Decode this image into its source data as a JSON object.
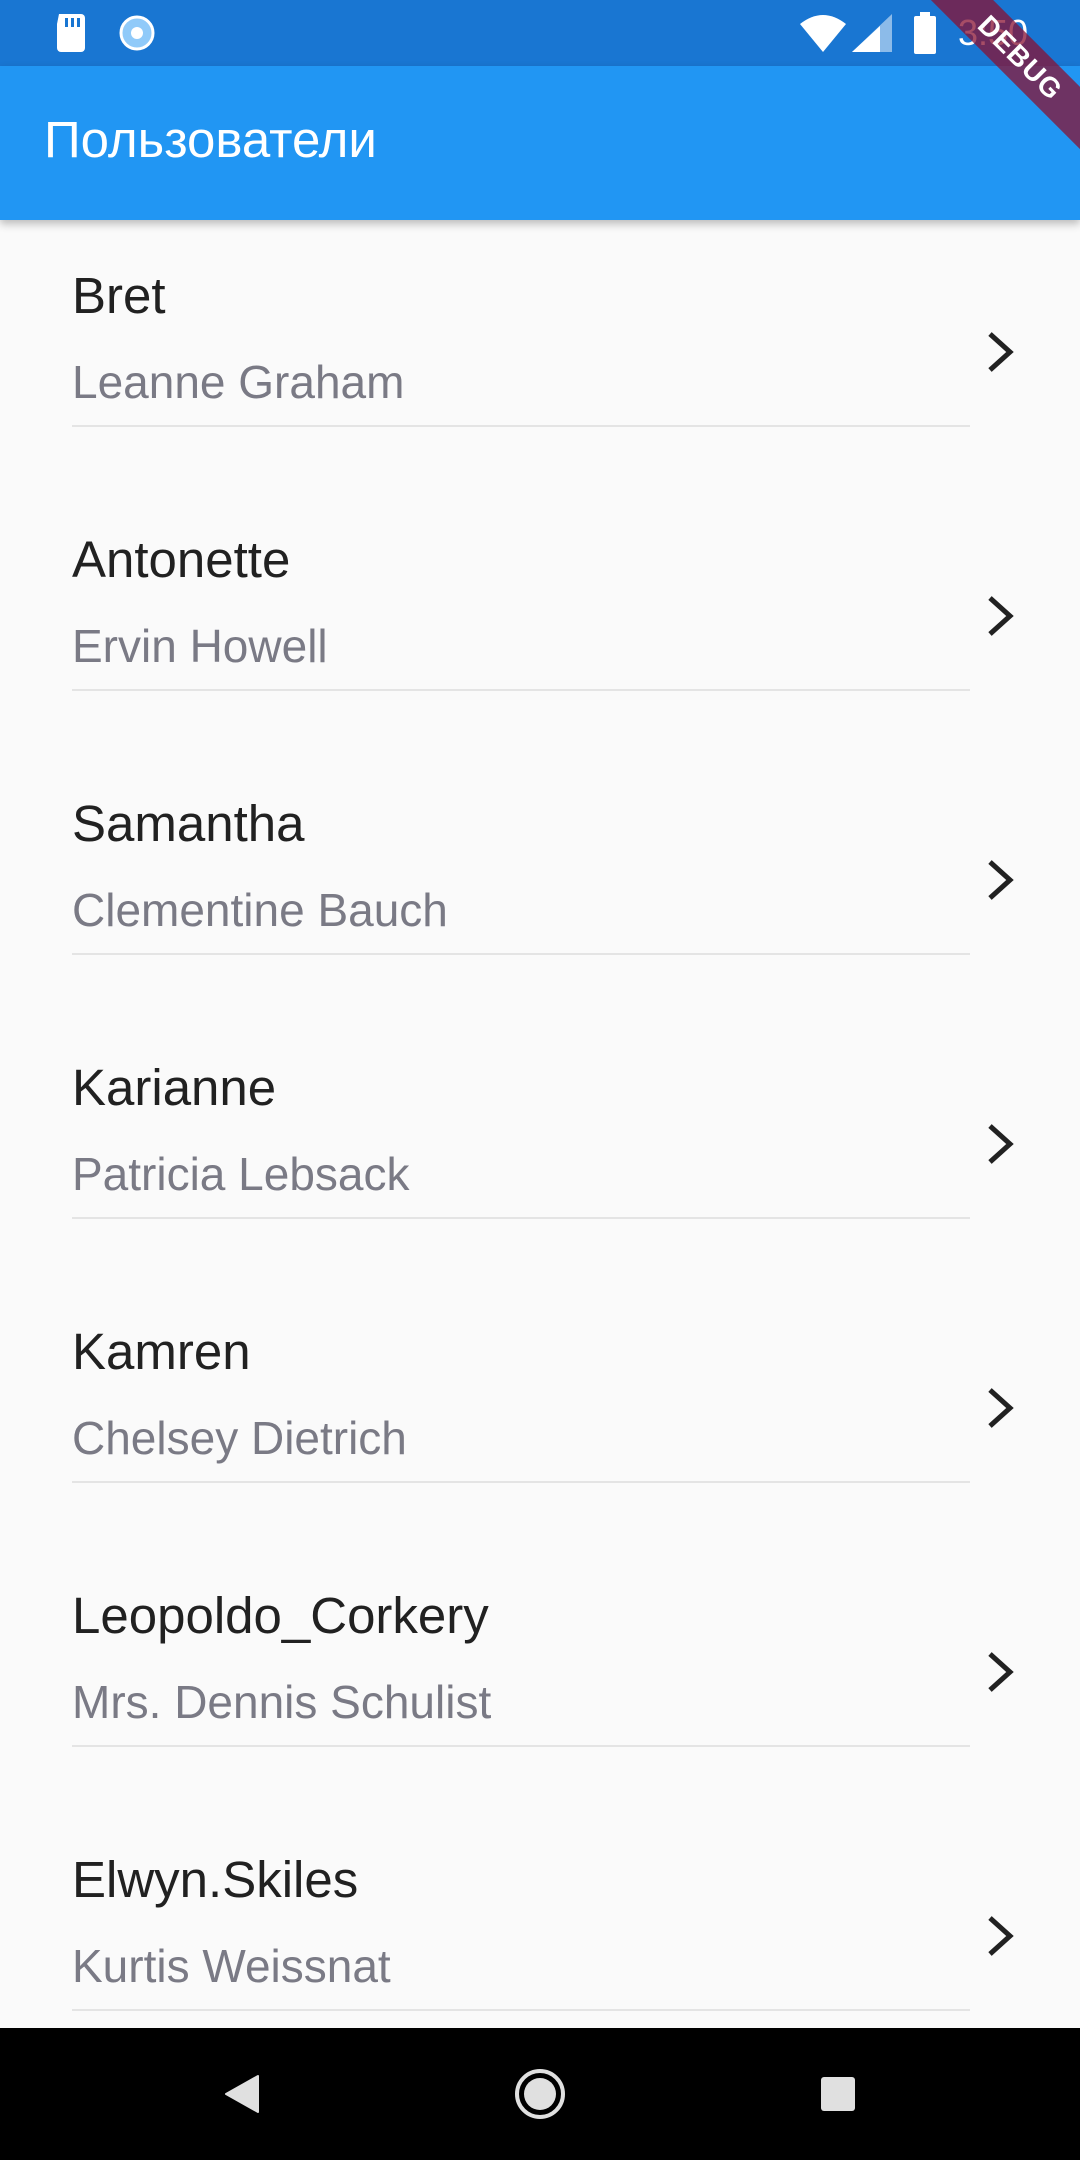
{
  "status_bar": {
    "time": "3:50",
    "icons": [
      "sd-card-icon",
      "sync-icon",
      "wifi-icon",
      "signal-icon",
      "battery-icon"
    ]
  },
  "app_bar": {
    "title": "Пользователи",
    "color": "#2196f3"
  },
  "debug_banner": "DEBUG",
  "users": [
    {
      "username": "Bret",
      "name": "Leanne Graham"
    },
    {
      "username": "Antonette",
      "name": "Ervin Howell"
    },
    {
      "username": "Samantha",
      "name": "Clementine Bauch"
    },
    {
      "username": "Karianne",
      "name": "Patricia Lebsack"
    },
    {
      "username": "Kamren",
      "name": "Chelsey Dietrich"
    },
    {
      "username": "Leopoldo_Corkery",
      "name": "Mrs. Dennis Schulist"
    },
    {
      "username": "Elwyn.Skiles",
      "name": "Kurtis Weissnat"
    }
  ],
  "nav_bar": {
    "buttons": [
      "back-icon",
      "home-icon",
      "recents-icon"
    ]
  }
}
